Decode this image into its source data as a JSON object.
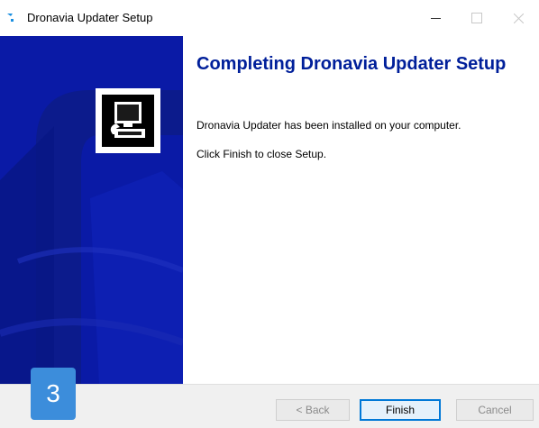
{
  "window": {
    "title": "Dronavia Updater Setup"
  },
  "content": {
    "heading": "Completing Dronavia Updater Setup",
    "line1": "Dronavia Updater has been installed on your computer.",
    "line2": "Click Finish to close Setup."
  },
  "buttons": {
    "back": "< Back",
    "finish": "Finish",
    "cancel": "Cancel"
  },
  "overlay": {
    "step": "3"
  },
  "colors": {
    "banner": "#0a1aa6",
    "heading": "#001f9a",
    "badge": "#3c8ddb",
    "focus": "#0078d7"
  },
  "icons": {
    "app": "installer-icon",
    "banner_logo": "computer-installer-icon"
  }
}
